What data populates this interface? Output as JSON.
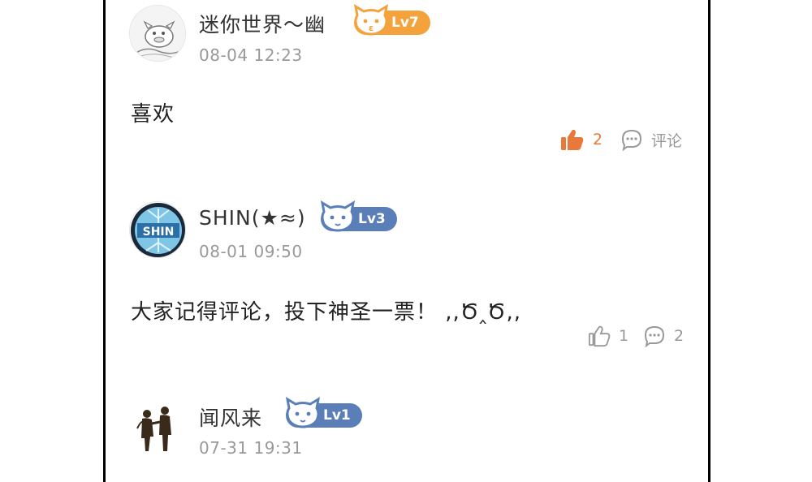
{
  "comments": [
    {
      "username": "迷你世界～幽",
      "level": "Lv7",
      "level_color": "#f3a23c",
      "timestamp": "08-04 12:23",
      "content": "喜欢",
      "likes": "2",
      "liked": true,
      "reply_label": "评论"
    },
    {
      "username": "SHIN(★≈)",
      "level": "Lv3",
      "level_color": "#5a7fb8",
      "timestamp": "08-01 09:50",
      "content": "大家记得评论，投下神圣一票！ ,,Ծ‸Ծ,,",
      "avatar_text": "SHIN",
      "likes": "1",
      "liked": false,
      "replies": "2"
    },
    {
      "username": "闻风来",
      "level": "Lv1",
      "level_color": "#5a7fb8",
      "timestamp": "07-31 19:31"
    }
  ],
  "colors": {
    "liked": "#e8793a",
    "muted": "#999999",
    "text": "#222222"
  }
}
